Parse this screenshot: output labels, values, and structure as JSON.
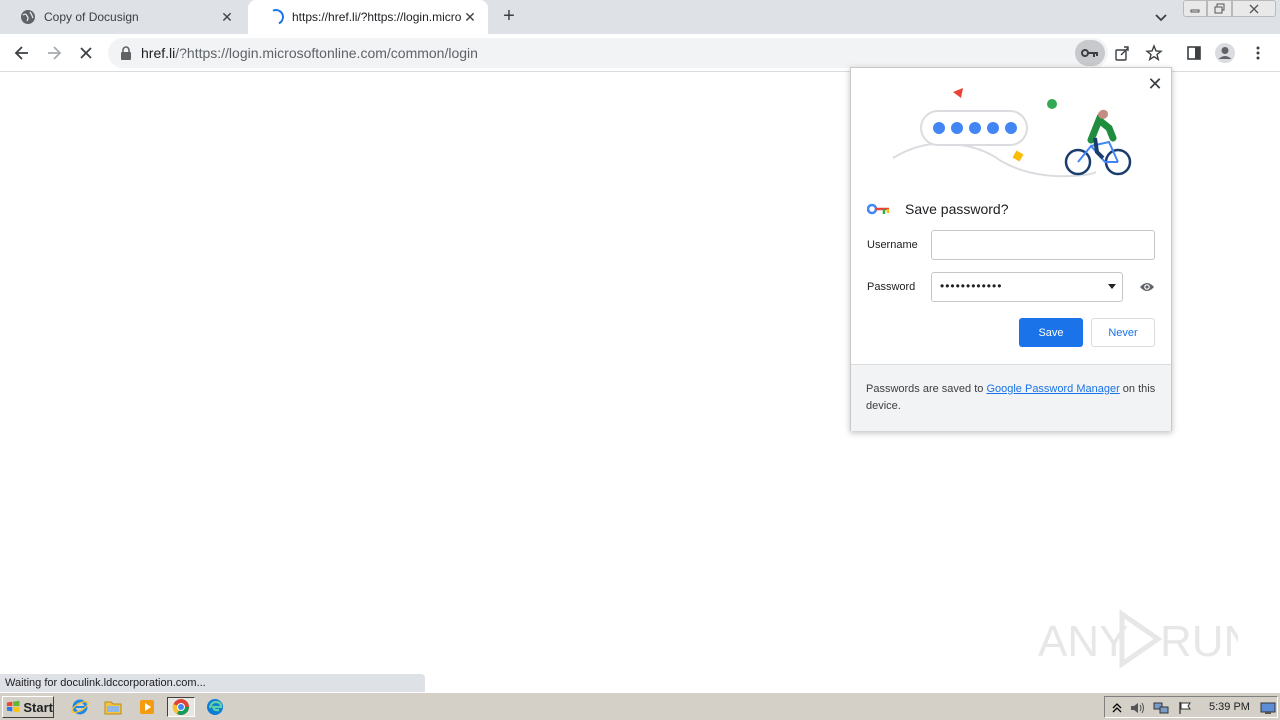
{
  "browser": {
    "tabs": [
      {
        "title": "Copy of Docusign",
        "active": false
      },
      {
        "title": "https://href.li/?https://login.microsoftonline.com/common/login",
        "active": true
      }
    ],
    "url_host": "href.li",
    "url_rest": "/?https://login.microsoftonline.com/common/login"
  },
  "popup": {
    "title": "Save password?",
    "username_label": "Username",
    "username_value": "",
    "password_label": "Password",
    "password_value": "••••••••••••",
    "save_label": "Save",
    "never_label": "Never",
    "footer_prefix": "Passwords are saved to ",
    "footer_link": "Google Password Manager",
    "footer_suffix": " on this device."
  },
  "status_text": "Waiting for doculink.ldccorporation.com...",
  "watermark": "ANY RUN",
  "taskbar": {
    "start_label": "Start",
    "clock": "5:39 PM"
  },
  "colors": {
    "accent": "#1a73e8",
    "tabstrip": "#dee1e6",
    "taskbar": "#d4d0c8"
  }
}
